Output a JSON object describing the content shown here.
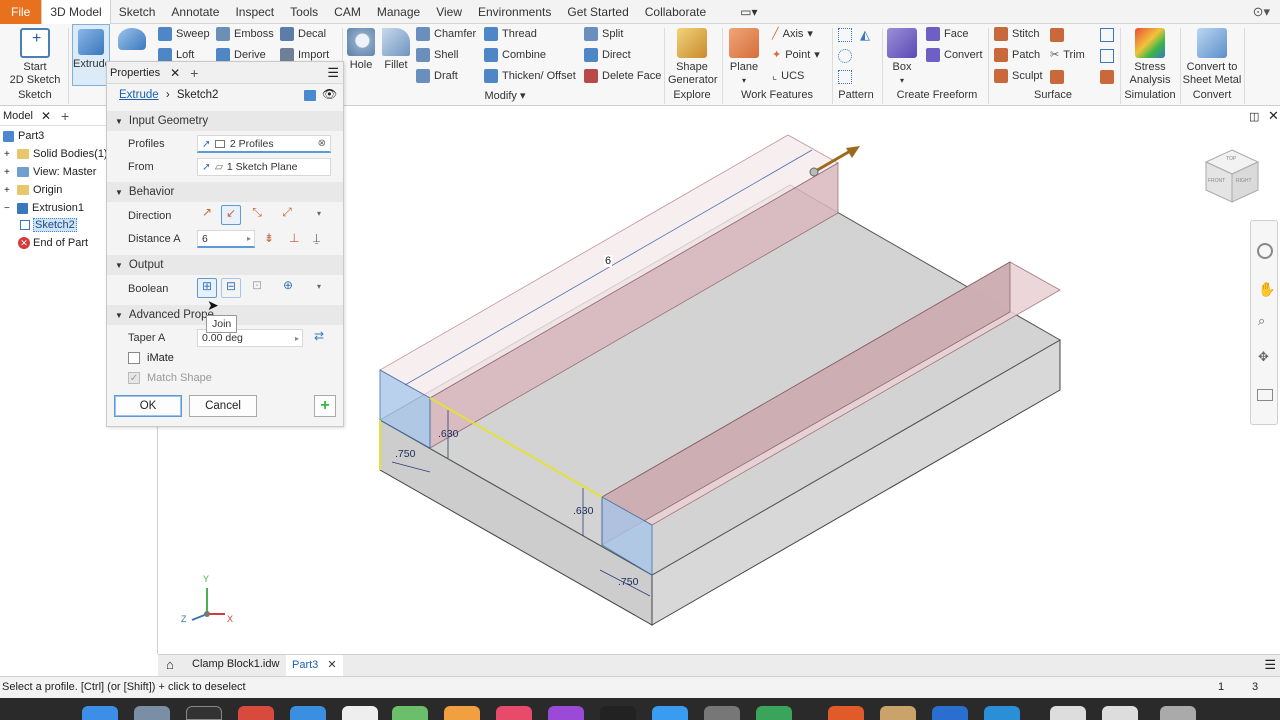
{
  "menu": {
    "items": [
      "File",
      "3D Model",
      "Sketch",
      "Annotate",
      "Inspect",
      "Tools",
      "CAM",
      "Manage",
      "View",
      "Environments",
      "Get Started",
      "Collaborate"
    ]
  },
  "ribbon": {
    "start_sketch": "Start\n2D Sketch",
    "sketch_group": "Sketch",
    "extrude": "Extrude",
    "create_small": [
      "Sweep",
      "Loft",
      "Emboss",
      "Derive",
      "Decal",
      "Import"
    ],
    "hole": "Hole",
    "fillet": "Fillet",
    "modify_small": [
      "Chamfer",
      "Shell",
      "Draft",
      "Thread",
      "Combine",
      "Thicken/ Offset",
      "Split",
      "Direct",
      "Delete Face"
    ],
    "modify_group": "Modify",
    "shape_generator": "Shape\nGenerator",
    "explore_group": "Explore",
    "plane": "Plane",
    "work_small": [
      "Axis",
      "Point",
      "UCS"
    ],
    "work_group": "Work Features",
    "pattern_group": "Pattern",
    "box": "Box",
    "freeform_small": [
      "Face",
      "Convert"
    ],
    "freeform_group": "Create Freeform",
    "surface_small": [
      "Stitch",
      "Patch",
      "Sculpt",
      "Trim"
    ],
    "surface_group": "Surface",
    "stress": "Stress\nAnalysis",
    "simulation_group": "Simulation",
    "sheet_metal": "Convert to\nSheet Metal",
    "convert_group": "Convert"
  },
  "browser": {
    "tab": "Model",
    "items": [
      "Part3",
      "Solid Bodies(1)",
      "View: Master",
      "Origin",
      "Extrusion1",
      "Sketch2",
      "End of Part"
    ]
  },
  "properties": {
    "tab": "Properties",
    "breadcrumb_link": "Extrude",
    "breadcrumb_current": "Sketch2",
    "input_geometry": "Input Geometry",
    "profiles_label": "Profiles",
    "profiles_value": "2 Profiles",
    "from_label": "From",
    "from_value": "1 Sketch Plane",
    "behavior": "Behavior",
    "direction_label": "Direction",
    "distance_label": "Distance A",
    "distance_value": "6",
    "output": "Output",
    "boolean_label": "Boolean",
    "tooltip": "Join",
    "advanced": "Advanced Prope",
    "taper_label": "Taper A",
    "taper_value": "0.00 deg",
    "imate": "iMate",
    "match_shape": "Match Shape",
    "ok": "OK",
    "cancel": "Cancel"
  },
  "viewport": {
    "dim_length": "6",
    "dim_h1": ".630",
    "dim_w1": ".750",
    "dim_h2": ".630",
    "dim_w2": ".750",
    "axis_x": "X",
    "axis_y": "Y",
    "axis_z": "Z",
    "viewcube_top": "TOP",
    "viewcube_front": "FRONT",
    "viewcube_right": "RIGHT"
  },
  "doctabs": {
    "tabs": [
      "Clamp Block1.idw",
      "Part3"
    ]
  },
  "status": {
    "message": "Select a profile. [Ctrl] (or [Shift]) + click to deselect",
    "count1": "1",
    "count2": "3"
  }
}
